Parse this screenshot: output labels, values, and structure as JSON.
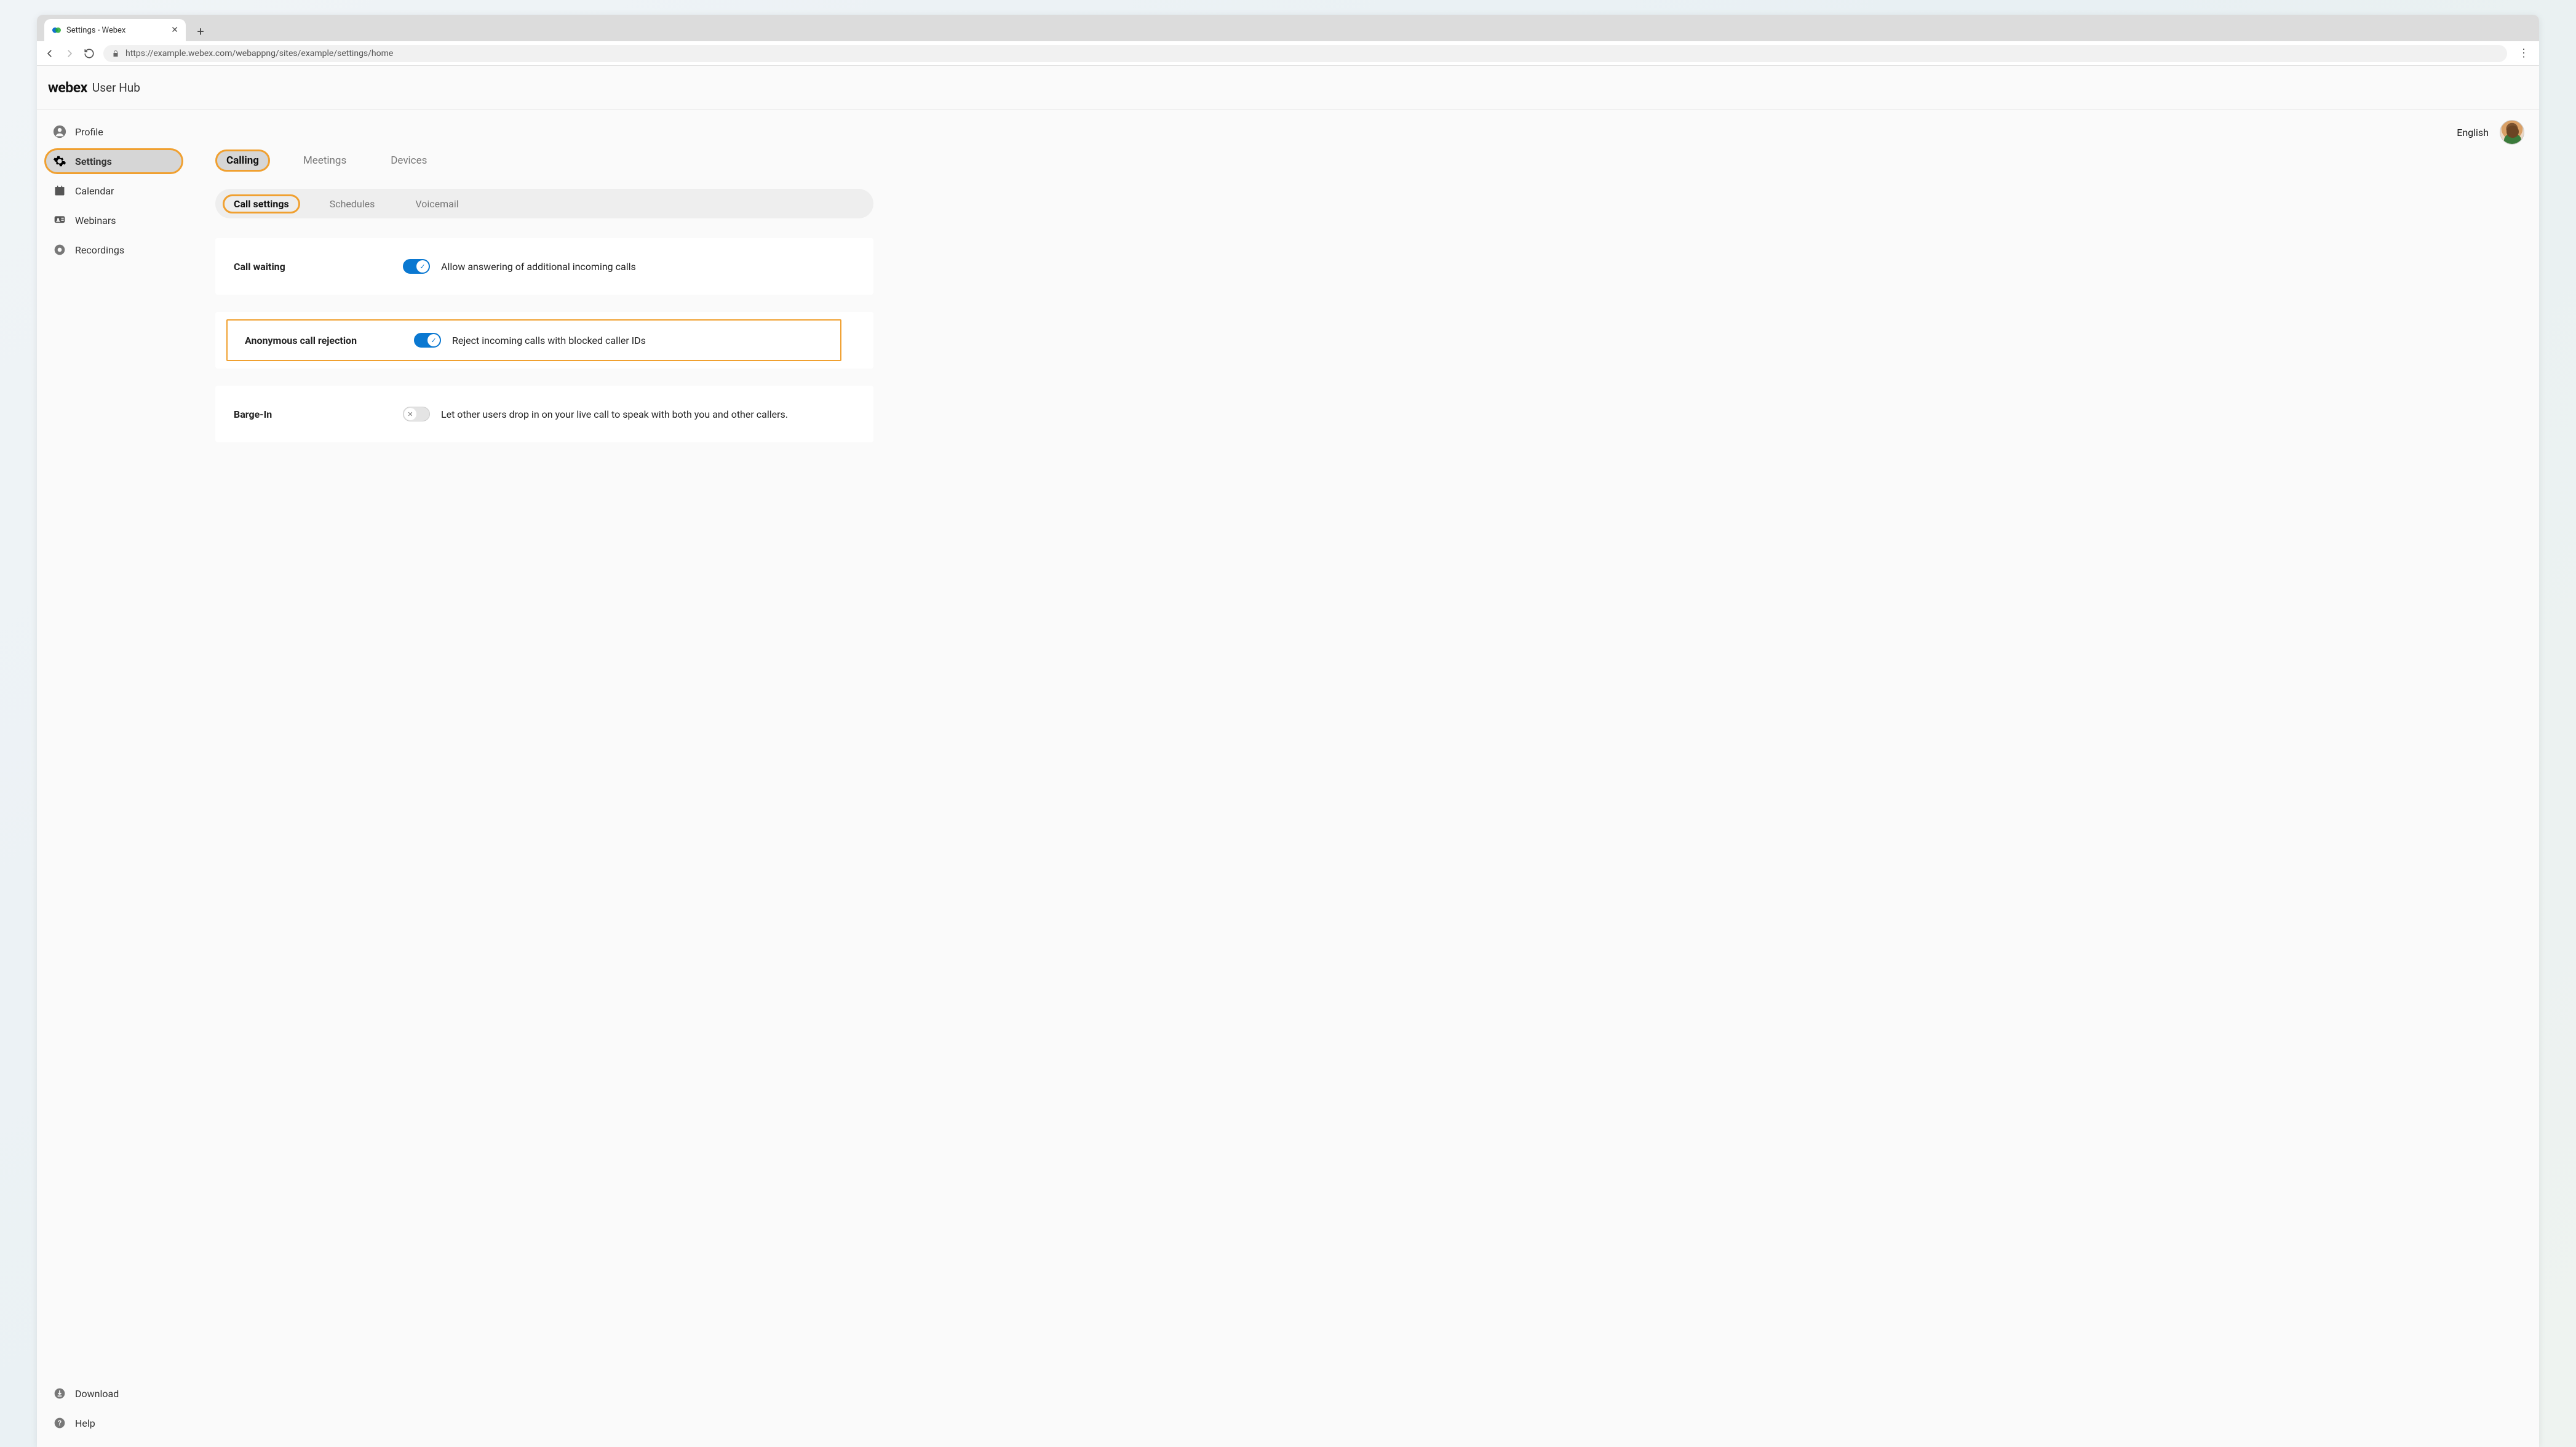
{
  "browser": {
    "tab_title": "Settings - Webex",
    "url": "https://example.webex.com/webappng/sites/example/settings/home"
  },
  "header": {
    "brand": "webex",
    "product": "User Hub",
    "language": "English"
  },
  "sidebar": {
    "items": [
      {
        "label": "Profile"
      },
      {
        "label": "Settings"
      },
      {
        "label": "Calendar"
      },
      {
        "label": "Webinars"
      },
      {
        "label": "Recordings"
      }
    ],
    "footer": [
      {
        "label": "Download"
      },
      {
        "label": "Help"
      }
    ]
  },
  "tabs_primary": [
    {
      "label": "Calling"
    },
    {
      "label": "Meetings"
    },
    {
      "label": "Devices"
    }
  ],
  "subtabs": [
    {
      "label": "Call settings"
    },
    {
      "label": "Schedules"
    },
    {
      "label": "Voicemail"
    }
  ],
  "settings": {
    "call_waiting": {
      "title": "Call waiting",
      "desc": "Allow answering of additional incoming calls",
      "on": true
    },
    "anonymous_reject": {
      "title": "Anonymous call rejection",
      "desc": "Reject incoming calls with blocked caller IDs",
      "on": true
    },
    "barge_in": {
      "title": "Barge-In",
      "desc": "Let other users drop in on your live call to speak with both you and other callers.",
      "on": false
    }
  }
}
